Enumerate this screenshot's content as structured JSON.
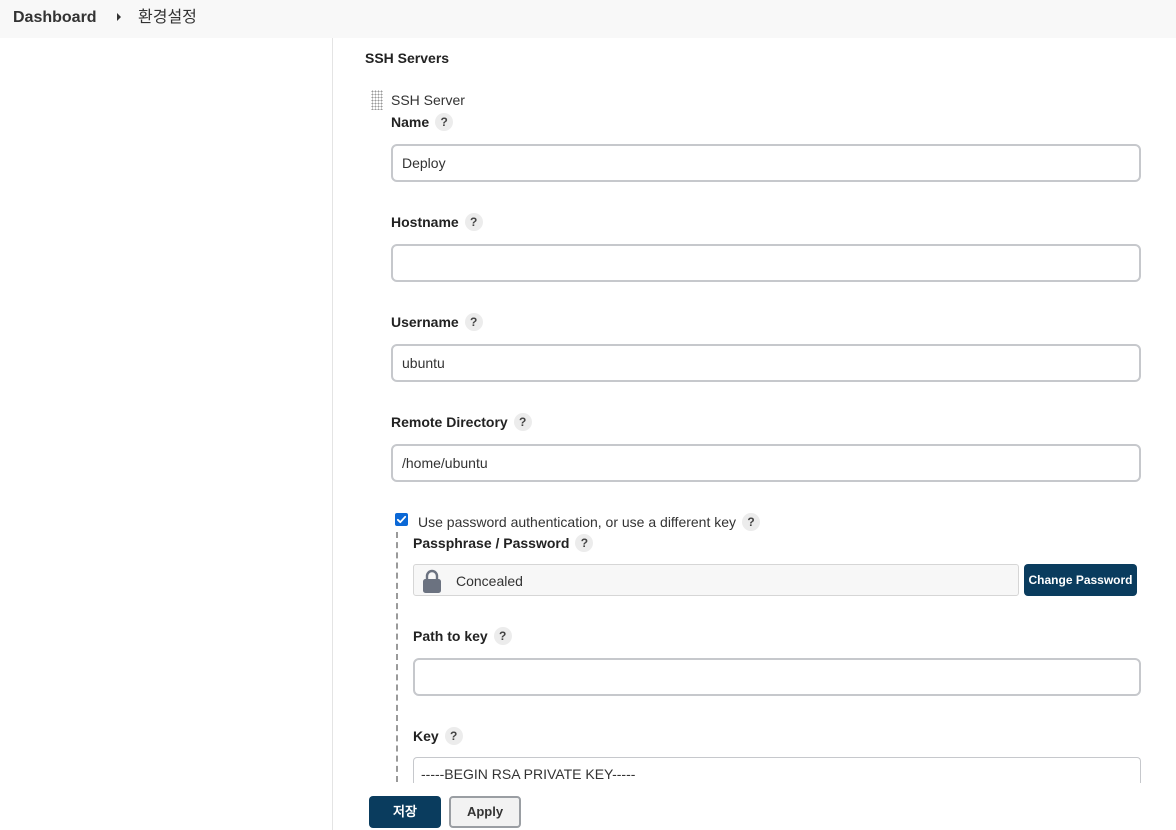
{
  "breadcrumb": {
    "dashboard": "Dashboard",
    "current": "환경설정"
  },
  "section": {
    "title": "SSH Servers",
    "block_title": "SSH Server"
  },
  "help_glyph": "?",
  "fields": {
    "name": {
      "label": "Name",
      "value": "Deploy"
    },
    "hostname": {
      "label": "Hostname",
      "value": ""
    },
    "username": {
      "label": "Username",
      "value": "ubuntu"
    },
    "remote_directory": {
      "label": "Remote Directory",
      "value": "/home/ubuntu"
    }
  },
  "auth": {
    "checkbox_label": "Use password authentication, or use a different key",
    "checked": true,
    "passphrase_label": "Passphrase / Password",
    "concealed_text": "Concealed",
    "change_password_label": "Change Password",
    "path_to_key_label": "Path to key",
    "path_to_key_value": "",
    "key_label": "Key",
    "key_first_line": "-----BEGIN RSA PRIVATE KEY-----"
  },
  "actions": {
    "save_label": "저장",
    "apply_label": "Apply"
  },
  "colors": {
    "primary_button": "#0a3c5e",
    "checkbox": "#0b68d6",
    "topbar_bg": "#f8f8f8"
  },
  "icons": {
    "breadcrumb_separator": "chevron-right-icon",
    "concealed": "lock-icon",
    "drag": "drag-handle-icon",
    "help": "help-icon"
  }
}
